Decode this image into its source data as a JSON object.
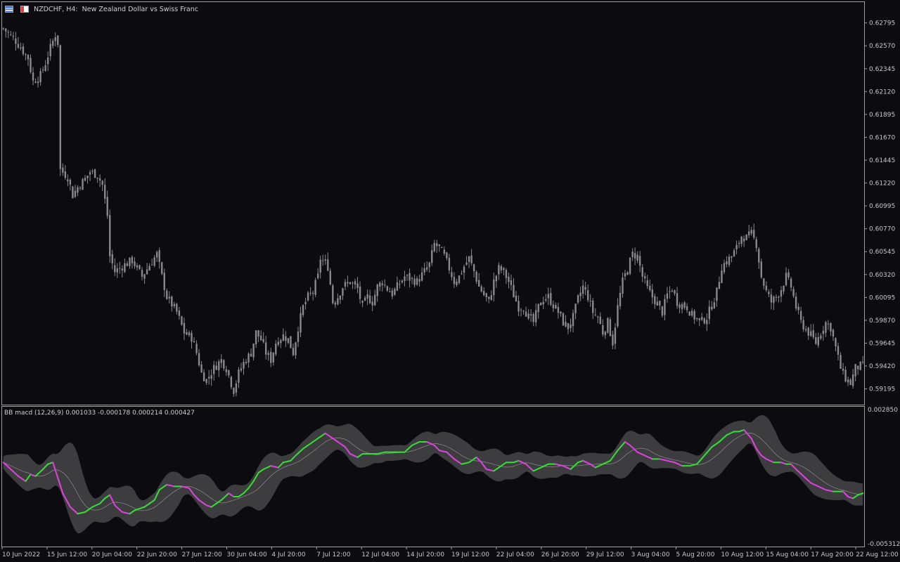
{
  "header": {
    "symbol": "NZDCHF, H4:",
    "description": "New Zealand Dollar vs Swiss Franc",
    "symbol_icon": "chart-list-icon",
    "trade_icon": "one-click-trading-icon"
  },
  "indicator": {
    "label": "BB macd (12,26,9) 0.001033 -0.000178 0.000214 0.000427"
  },
  "colors": {
    "background": "#0b0b10",
    "candle": "#8a8a8a",
    "band_fill": "#3d3d40",
    "macd_up": "#32e032",
    "macd_down": "#e040e0",
    "mid_line": "#9a9a9a",
    "axis_text": "#c8c8c8",
    "frame": "#a0a0a0"
  },
  "chart_data": [
    {
      "type": "candlestick",
      "title": "NZDCHF, H4",
      "timeframe": "H4",
      "y_ticks": [
        "0.62795",
        "0.62570",
        "0.62345",
        "0.62120",
        "0.61895",
        "0.61670",
        "0.61445",
        "0.61220",
        "0.60995",
        "0.60770",
        "0.60545",
        "0.60320",
        "0.60095",
        "0.59870",
        "0.59645",
        "0.59420",
        "0.59195"
      ],
      "ylim": [
        0.5904,
        0.63
      ],
      "x_ticks": [
        "10 Jun 2022",
        "15 Jun 12:00",
        "20 Jun 04:00",
        "22 Jun 20:00",
        "27 Jun 12:00",
        "30 Jun 04:00",
        "4 Jul 20:00",
        "7 Jul 12:00",
        "12 Jul 04:00",
        "14 Jul 20:00",
        "19 Jul 12:00",
        "22 Jul 04:00",
        "26 Jul 20:00",
        "29 Jul 12:00",
        "3 Aug 04:00",
        "5 Aug 20:00",
        "10 Aug 12:00",
        "15 Aug 04:00",
        "17 Aug 20:00",
        "22 Aug 12:00"
      ],
      "close_path": [
        [
          0,
          0.6274
        ],
        [
          5,
          0.6262
        ],
        [
          10,
          0.6245
        ],
        [
          12,
          0.6222
        ],
        [
          15,
          0.6228
        ],
        [
          17,
          0.624
        ],
        [
          19,
          0.6255
        ],
        [
          21,
          0.6268
        ],
        [
          22,
          0.626
        ],
        [
          23,
          0.6135
        ],
        [
          26,
          0.6128
        ],
        [
          28,
          0.611
        ],
        [
          30,
          0.6118
        ],
        [
          33,
          0.6126
        ],
        [
          35,
          0.6133
        ],
        [
          38,
          0.613
        ],
        [
          40,
          0.612
        ],
        [
          42,
          0.609
        ],
        [
          43,
          0.605
        ],
        [
          45,
          0.6035
        ],
        [
          48,
          0.604
        ],
        [
          52,
          0.6046
        ],
        [
          56,
          0.603
        ],
        [
          60,
          0.6045
        ],
        [
          62,
          0.6052
        ],
        [
          64,
          0.603
        ],
        [
          66,
          0.601
        ],
        [
          70,
          0.5995
        ],
        [
          73,
          0.5975
        ],
        [
          76,
          0.597
        ],
        [
          78,
          0.5955
        ],
        [
          80,
          0.5935
        ],
        [
          82,
          0.5928
        ],
        [
          85,
          0.594
        ],
        [
          88,
          0.5948
        ],
        [
          90,
          0.594
        ],
        [
          92,
          0.5925
        ],
        [
          93,
          0.5918
        ],
        [
          95,
          0.5935
        ],
        [
          97,
          0.5945
        ],
        [
          100,
          0.5955
        ],
        [
          102,
          0.5975
        ],
        [
          104,
          0.5968
        ],
        [
          106,
          0.5955
        ],
        [
          108,
          0.5948
        ],
        [
          110,
          0.5965
        ],
        [
          113,
          0.5972
        ],
        [
          115,
          0.5968
        ],
        [
          117,
          0.5955
        ],
        [
          119,
          0.598
        ],
        [
          121,
          0.6
        ],
        [
          123,
          0.601
        ],
        [
          125,
          0.6015
        ],
        [
          127,
          0.603
        ],
        [
          128,
          0.6048
        ],
        [
          131,
          0.604
        ],
        [
          133,
          0.6005
        ],
        [
          135,
          0.601
        ],
        [
          137,
          0.602
        ],
        [
          140,
          0.6025
        ],
        [
          143,
          0.6018
        ],
        [
          145,
          0.6
        ],
        [
          147,
          0.601
        ],
        [
          149,
          0.6005
        ],
        [
          151,
          0.602
        ],
        [
          153,
          0.6025
        ],
        [
          155,
          0.6018
        ],
        [
          157,
          0.6013
        ],
        [
          159,
          0.602
        ],
        [
          162,
          0.603
        ],
        [
          165,
          0.6027
        ],
        [
          167,
          0.6025
        ],
        [
          170,
          0.6035
        ],
        [
          172,
          0.6042
        ],
        [
          174,
          0.6062
        ],
        [
          176,
          0.6058
        ],
        [
          178,
          0.605
        ],
        [
          180,
          0.6038
        ],
        [
          182,
          0.6025
        ],
        [
          184,
          0.603
        ],
        [
          186,
          0.604
        ],
        [
          188,
          0.6048
        ],
        [
          190,
          0.6035
        ],
        [
          192,
          0.602
        ],
        [
          194,
          0.6012
        ],
        [
          196,
          0.6005
        ],
        [
          198,
          0.6025
        ],
        [
          200,
          0.6038
        ],
        [
          202,
          0.6035
        ],
        [
          204,
          0.6025
        ],
        [
          206,
          0.6012
        ],
        [
          208,
          0.6
        ],
        [
          210,
          0.6
        ],
        [
          212,
          0.599
        ],
        [
          214,
          0.5985
        ],
        [
          216,
          0.6
        ],
        [
          218,
          0.6008
        ],
        [
          220,
          0.601
        ],
        [
          222,
          0.6002
        ],
        [
          224,
          0.5995
        ],
        [
          226,
          0.5985
        ],
        [
          228,
          0.598
        ],
        [
          230,
          0.599
        ],
        [
          232,
          0.6008
        ],
        [
          234,
          0.602
        ],
        [
          236,
          0.601
        ],
        [
          238,
          0.5995
        ],
        [
          240,
          0.599
        ],
        [
          242,
          0.5975
        ],
        [
          244,
          0.5985
        ],
        [
          246,
          0.5965
        ],
        [
          248,
          0.6
        ],
        [
          250,
          0.6025
        ],
        [
          252,
          0.6038
        ],
        [
          254,
          0.6052
        ],
        [
          256,
          0.605
        ],
        [
          258,
          0.603
        ],
        [
          260,
          0.6018
        ],
        [
          262,
          0.601
        ],
        [
          264,
          0.6003
        ],
        [
          266,
          0.5995
        ],
        [
          268,
          0.6012
        ],
        [
          270,
          0.6018
        ],
        [
          272,
          0.6005
        ],
        [
          274,
          0.6002
        ],
        [
          276,
          0.6
        ],
        [
          278,
          0.5992
        ],
        [
          280,
          0.5988
        ],
        [
          282,
          0.5986
        ],
        [
          284,
          0.599
        ],
        [
          286,
          0.6002
        ],
        [
          288,
          0.6015
        ],
        [
          290,
          0.604
        ],
        [
          292,
          0.6045
        ],
        [
          294,
          0.605
        ],
        [
          296,
          0.6058
        ],
        [
          298,
          0.607
        ],
        [
          300,
          0.6068
        ],
        [
          302,
          0.6072
        ],
        [
          304,
          0.6062
        ],
        [
          306,
          0.603
        ],
        [
          308,
          0.6015
        ],
        [
          310,
          0.6005
        ],
        [
          312,
          0.601
        ],
        [
          314,
          0.6018
        ],
        [
          316,
          0.603
        ],
        [
          318,
          0.602
        ],
        [
          320,
          0.6
        ],
        [
          322,
          0.5985
        ],
        [
          324,
          0.5978
        ],
        [
          326,
          0.5972
        ],
        [
          328,
          0.5965
        ],
        [
          330,
          0.5975
        ],
        [
          332,
          0.5985
        ],
        [
          334,
          0.598
        ],
        [
          336,
          0.596
        ],
        [
          338,
          0.594
        ],
        [
          340,
          0.593
        ],
        [
          342,
          0.5925
        ],
        [
          344,
          0.594
        ],
        [
          346,
          0.5942
        ]
      ]
    },
    {
      "type": "area",
      "title": "BB macd (12,26,9)",
      "values_shown": [
        0.001033,
        -0.000178,
        0.000214,
        0.000427
      ],
      "y_ticks": [
        "0.002850",
        "-0.005312"
      ],
      "ylim": [
        -0.005312,
        0.00285
      ],
      "macd": [
        [
          0,
          -0.0004
        ],
        [
          3,
          -0.0008
        ],
        [
          6,
          -0.0012
        ],
        [
          9,
          -0.0015
        ],
        [
          11,
          -0.0011
        ],
        [
          13,
          -0.0012
        ],
        [
          16,
          -0.0008
        ],
        [
          18,
          -0.0005
        ],
        [
          20,
          -0.0004
        ],
        [
          22,
          -0.0013
        ],
        [
          24,
          -0.0022
        ],
        [
          27,
          -0.003
        ],
        [
          30,
          -0.0034
        ],
        [
          33,
          -0.0033
        ],
        [
          36,
          -0.003
        ],
        [
          39,
          -0.0028
        ],
        [
          41,
          -0.0025
        ],
        [
          43,
          -0.0023
        ],
        [
          45,
          -0.0029
        ],
        [
          48,
          -0.0033
        ],
        [
          51,
          -0.0034
        ],
        [
          53,
          -0.0032
        ],
        [
          55,
          -0.0031
        ],
        [
          57,
          -0.003
        ],
        [
          59,
          -0.0028
        ],
        [
          61,
          -0.0026
        ],
        [
          63,
          -0.002
        ],
        [
          66,
          -0.0017
        ],
        [
          69,
          -0.0018
        ],
        [
          72,
          -0.0018
        ],
        [
          75,
          -0.0019
        ],
        [
          77,
          -0.0023
        ],
        [
          79,
          -0.0026
        ],
        [
          82,
          -0.0029
        ],
        [
          84,
          -0.003
        ],
        [
          86,
          -0.0028
        ],
        [
          88,
          -0.0026
        ],
        [
          91,
          -0.0022
        ],
        [
          93,
          -0.0024
        ],
        [
          95,
          -0.0024
        ],
        [
          97,
          -0.0022
        ],
        [
          99,
          -0.0019
        ],
        [
          101,
          -0.0015
        ],
        [
          103,
          -0.001
        ],
        [
          105,
          -0.0008
        ],
        [
          108,
          -0.0006
        ],
        [
          111,
          -0.0007
        ],
        [
          113,
          -0.0004
        ],
        [
          116,
          -0.0003
        ],
        [
          118,
          0.0
        ],
        [
          121,
          0.0004
        ],
        [
          124,
          0.0007
        ],
        [
          127,
          0.001
        ],
        [
          130,
          0.0013
        ],
        [
          133,
          0.001
        ],
        [
          135,
          0.0008
        ],
        [
          138,
          0.0005
        ],
        [
          140,
          0.0001
        ],
        [
          143,
          -0.0001
        ],
        [
          145,
          0.0001
        ],
        [
          148,
          0.0001
        ],
        [
          151,
          0.0001
        ],
        [
          154,
          0.0002
        ],
        [
          158,
          0.0002
        ],
        [
          162,
          0.0002
        ],
        [
          165,
          0.0006
        ],
        [
          168,
          0.0008
        ],
        [
          171,
          0.0008
        ],
        [
          174,
          0.0006
        ],
        [
          176,
          0.0003
        ],
        [
          179,
          0.0002
        ],
        [
          182,
          -0.0002
        ],
        [
          185,
          -0.0005
        ],
        [
          188,
          -0.0004
        ],
        [
          191,
          -0.0001
        ],
        [
          193,
          -0.0004
        ],
        [
          195,
          -0.0008
        ],
        [
          198,
          -0.0009
        ],
        [
          201,
          -0.0006
        ],
        [
          203,
          -0.0004
        ],
        [
          206,
          -0.0004
        ],
        [
          208,
          -0.0003
        ],
        [
          211,
          -0.0005
        ],
        [
          214,
          -0.0009
        ],
        [
          217,
          -0.0007
        ],
        [
          220,
          -0.0005
        ],
        [
          223,
          -0.0005
        ],
        [
          226,
          -0.0006
        ],
        [
          229,
          -0.0008
        ],
        [
          232,
          -0.0004
        ],
        [
          234,
          -0.0003
        ],
        [
          237,
          -0.0005
        ],
        [
          239,
          -0.0007
        ],
        [
          242,
          -0.0005
        ],
        [
          245,
          -0.0003
        ],
        [
          248,
          0.0003
        ],
        [
          251,
          0.0008
        ],
        [
          253,
          0.0006
        ],
        [
          256,
          0.0002
        ],
        [
          259,
          0.0
        ],
        [
          262,
          -0.0002
        ],
        [
          265,
          -0.0002
        ],
        [
          268,
          -0.0003
        ],
        [
          271,
          -0.0004
        ],
        [
          274,
          -0.0006
        ],
        [
          277,
          -0.0006
        ],
        [
          280,
          -0.0005
        ],
        [
          283,
          0.0
        ],
        [
          286,
          0.0005
        ],
        [
          289,
          0.0008
        ],
        [
          292,
          0.0012
        ],
        [
          295,
          0.0014
        ],
        [
          297,
          0.0014
        ],
        [
          299,
          0.0015
        ],
        [
          302,
          0.001
        ],
        [
          304,
          0.0004
        ],
        [
          306,
          0.0
        ],
        [
          308,
          -0.0002
        ],
        [
          311,
          -0.0004
        ],
        [
          314,
          -0.0004
        ],
        [
          316,
          -0.0005
        ],
        [
          318,
          -0.0005
        ],
        [
          320,
          -0.0008
        ],
        [
          323,
          -0.0012
        ],
        [
          326,
          -0.0016
        ],
        [
          329,
          -0.0018
        ],
        [
          332,
          -0.002
        ],
        [
          335,
          -0.0021
        ],
        [
          337,
          -0.0021
        ],
        [
          339,
          -0.0021
        ],
        [
          341,
          -0.0024
        ],
        [
          343,
          -0.0025
        ],
        [
          345,
          -0.0023
        ],
        [
          347,
          -0.0022
        ]
      ]
    }
  ]
}
